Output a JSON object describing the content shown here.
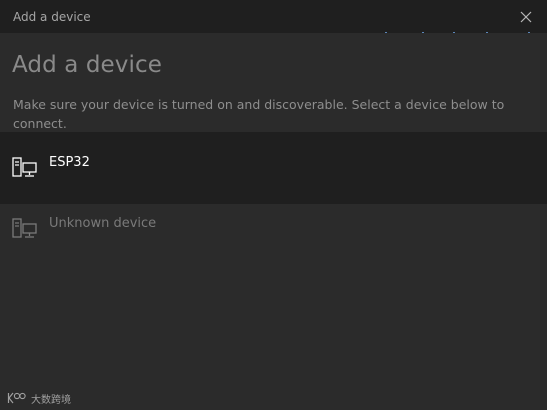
{
  "window": {
    "title": "Add a device",
    "accent_color": "#5a86b8"
  },
  "dialog": {
    "heading": "Add a device",
    "description": "Make sure your device is turned on and discoverable. Select a device below to connect."
  },
  "devices": [
    {
      "name": "ESP32",
      "icon": "computer-icon",
      "selected": true
    },
    {
      "name": "Unknown device",
      "icon": "computer-icon",
      "selected": false
    }
  ],
  "watermark": {
    "text": "大数跨境",
    "logo": "kdc-logo"
  },
  "colors": {
    "titlebar_bg": "#1f1f1f",
    "content_bg": "#2b2b2b",
    "selected_row_bg": "#1f1f1f"
  }
}
